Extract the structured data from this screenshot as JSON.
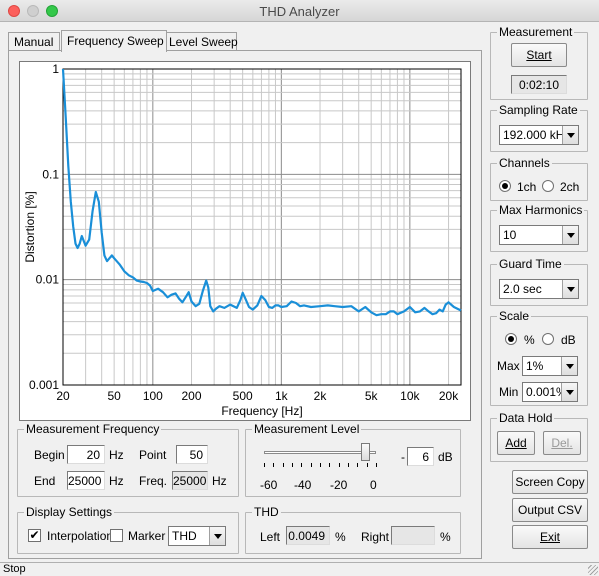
{
  "window": {
    "title": "THD Analyzer"
  },
  "tabs": [
    {
      "label": "Manual",
      "active": false
    },
    {
      "label": "Frequency Sweep",
      "active": true
    },
    {
      "label": "Level Sweep",
      "active": false
    }
  ],
  "chart_data": {
    "type": "line",
    "title": "",
    "xlabel": "Frequency [Hz]",
    "ylabel": "Distortion [%]",
    "x_scale": "log",
    "y_scale": "log",
    "xlim": [
      20,
      25000
    ],
    "ylim": [
      0.001,
      1
    ],
    "grid": true,
    "x_ticks": [
      20,
      50,
      100,
      200,
      500,
      1000,
      2000,
      5000,
      10000,
      20000
    ],
    "x_tick_labels": [
      "20",
      "50",
      "100",
      "200",
      "500",
      "1k",
      "2k",
      "5k",
      "10k",
      "20k"
    ],
    "y_ticks": [
      0.001,
      0.01,
      0.1,
      1
    ],
    "y_tick_labels": [
      "0.001",
      "0.01",
      "0.1",
      "1"
    ],
    "line_color": "#1a8fd8",
    "series": [
      {
        "x": [
          20,
          21,
          22,
          23,
          24,
          25,
          26,
          27,
          28,
          30,
          32,
          34,
          36,
          38,
          40,
          42,
          44,
          46,
          48,
          50,
          55,
          60,
          65,
          70,
          75,
          80,
          85,
          90,
          95,
          100,
          110,
          120,
          130,
          140,
          150,
          160,
          170,
          180,
          190,
          200,
          215,
          230,
          245,
          260,
          270,
          280,
          295,
          310,
          330,
          360,
          400,
          450,
          480,
          500,
          520,
          560,
          600,
          650,
          700,
          750,
          800,
          850,
          900,
          950,
          1000,
          1100,
          1200,
          1300,
          1400,
          1500,
          1700,
          2000,
          2300,
          2600,
          3000,
          3500,
          4000,
          4500,
          5000,
          5500,
          6000,
          6500,
          7000,
          7500,
          8000,
          9000,
          10000,
          11000,
          12000,
          13000,
          14000,
          15000,
          16000,
          17000,
          18000,
          19000,
          20000,
          22000,
          25000
        ],
        "y": [
          1.0,
          0.35,
          0.12,
          0.055,
          0.032,
          0.022,
          0.02,
          0.022,
          0.026,
          0.021,
          0.024,
          0.045,
          0.068,
          0.055,
          0.028,
          0.017,
          0.015,
          0.016,
          0.017,
          0.016,
          0.014,
          0.012,
          0.011,
          0.0105,
          0.0098,
          0.0096,
          0.0095,
          0.0093,
          0.0088,
          0.0078,
          0.0082,
          0.0076,
          0.0068,
          0.0072,
          0.0074,
          0.0066,
          0.0061,
          0.0068,
          0.0076,
          0.0062,
          0.0056,
          0.0059,
          0.0078,
          0.0098,
          0.0084,
          0.0056,
          0.005,
          0.0053,
          0.0056,
          0.0054,
          0.0058,
          0.0054,
          0.0064,
          0.0075,
          0.0068,
          0.0055,
          0.0052,
          0.0057,
          0.007,
          0.0064,
          0.0055,
          0.0054,
          0.0057,
          0.0057,
          0.0055,
          0.0056,
          0.0062,
          0.006,
          0.0056,
          0.0057,
          0.0055,
          0.0056,
          0.0057,
          0.0056,
          0.0055,
          0.0056,
          0.005,
          0.0055,
          0.0049,
          0.0046,
          0.0047,
          0.0047,
          0.005,
          0.005,
          0.0047,
          0.005,
          0.0055,
          0.0049,
          0.005,
          0.0054,
          0.005,
          0.0047,
          0.0048,
          0.0052,
          0.005,
          0.0058,
          0.0061,
          0.0055,
          0.0051
        ]
      }
    ]
  },
  "measurement_frequency": {
    "group_label": "Measurement Frequency",
    "begin_label": "Begin",
    "begin_value": "20",
    "begin_unit": "Hz",
    "point_label": "Point",
    "point_value": "50",
    "end_label": "End",
    "end_value": "25000",
    "end_unit": "Hz",
    "freq_label": "Freq.",
    "freq_value": "25000",
    "freq_unit": "Hz"
  },
  "measurement_level": {
    "group_label": "Measurement Level",
    "value_sign": "-",
    "value": "6",
    "unit": "dB",
    "slider_min": -60,
    "slider_max": 0,
    "slider_value": -6,
    "ticks": [
      "-60",
      "-40",
      "-20",
      "0"
    ]
  },
  "display_settings": {
    "group_label": "Display Settings",
    "interpolation_label": "Interpolation",
    "interpolation_checked": true,
    "marker_label": "Marker",
    "marker_checked": false,
    "mode_value": "THD"
  },
  "thd": {
    "group_label": "THD",
    "left_label": "Left",
    "left_value": "0.0049",
    "left_unit": "%",
    "right_label": "Right",
    "right_value": "",
    "right_unit": "%"
  },
  "measurement": {
    "group_label": "Measurement",
    "start_label": "Start",
    "elapsed": "0:02:10"
  },
  "sampling_rate": {
    "group_label": "Sampling Rate",
    "value": "192.000 kHz"
  },
  "channels": {
    "group_label": "Channels",
    "option_1ch": "1ch",
    "option_2ch": "2ch",
    "selected": "1ch"
  },
  "max_harmonics": {
    "group_label": "Max Harmonics",
    "value": "10"
  },
  "guard_time": {
    "group_label": "Guard Time",
    "value": "2.0 sec"
  },
  "scale": {
    "group_label": "Scale",
    "option_percent": "%",
    "option_db": "dB",
    "selected": "%",
    "max_label": "Max",
    "max_value": "1%",
    "min_label": "Min",
    "min_value": "0.001%"
  },
  "data_hold": {
    "group_label": "Data Hold",
    "add_label": "Add",
    "del_label": "Del."
  },
  "buttons": {
    "screen_copy": "Screen Copy",
    "output_csv": "Output CSV",
    "exit": "Exit"
  },
  "status": {
    "text": "Stop"
  }
}
